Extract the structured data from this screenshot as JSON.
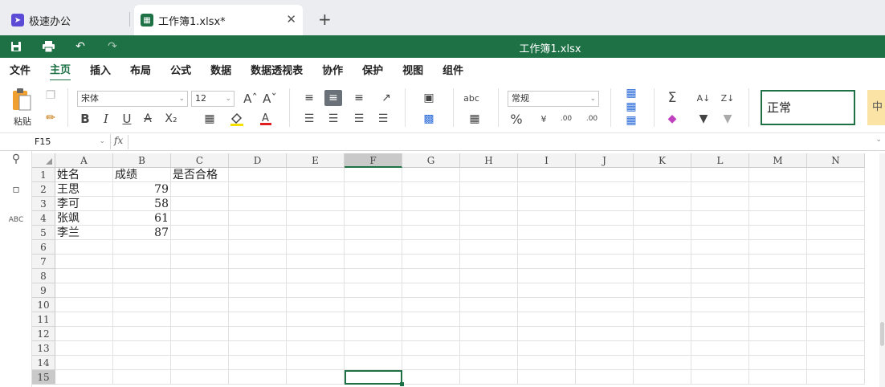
{
  "tabs": [
    {
      "label": "极速办公",
      "icon": "rocket-icon"
    },
    {
      "label": "工作簿1.xlsx*",
      "icon": "spreadsheet-icon"
    }
  ],
  "window_title": "工作簿1.xlsx",
  "menu": [
    "文件",
    "主页",
    "插入",
    "布局",
    "公式",
    "数据",
    "数据透视表",
    "协作",
    "保护",
    "视图",
    "组件"
  ],
  "active_menu": "主页",
  "ribbon": {
    "paste_label": "粘贴",
    "font_name": "宋体",
    "font_size": "12",
    "number_format": "常规",
    "style_normal": "正常",
    "style_neutral": "中"
  },
  "formula_bar": {
    "name_box": "F15",
    "fx_label": "fx",
    "formula": ""
  },
  "columns": [
    "A",
    "B",
    "C",
    "D",
    "E",
    "F",
    "G",
    "H",
    "I",
    "J",
    "K",
    "L",
    "M",
    "N"
  ],
  "rows": [
    "1",
    "2",
    "3",
    "4",
    "5",
    "6",
    "7",
    "8",
    "9",
    "10",
    "11",
    "12",
    "13",
    "14",
    "15"
  ],
  "selected_column": "F",
  "selected_row": "15",
  "cells": [
    {
      "row": 1,
      "col": "A",
      "value": "姓名",
      "align": "left"
    },
    {
      "row": 1,
      "col": "B",
      "value": "成绩",
      "align": "left"
    },
    {
      "row": 1,
      "col": "C",
      "value": "是否合格",
      "align": "left"
    },
    {
      "row": 2,
      "col": "A",
      "value": "王思",
      "align": "left"
    },
    {
      "row": 2,
      "col": "B",
      "value": "79",
      "align": "right"
    },
    {
      "row": 3,
      "col": "A",
      "value": "李可",
      "align": "left"
    },
    {
      "row": 3,
      "col": "B",
      "value": "58",
      "align": "right"
    },
    {
      "row": 4,
      "col": "A",
      "value": "张飒",
      "align": "left"
    },
    {
      "row": 4,
      "col": "B",
      "value": "61",
      "align": "right"
    },
    {
      "row": 5,
      "col": "A",
      "value": "李兰",
      "align": "left"
    },
    {
      "row": 5,
      "col": "B",
      "value": "87",
      "align": "right"
    }
  ],
  "colors": {
    "brand_green": "#1e7145",
    "header_gray": "#f3f3f3",
    "selected_header": "#c9c9c9"
  }
}
